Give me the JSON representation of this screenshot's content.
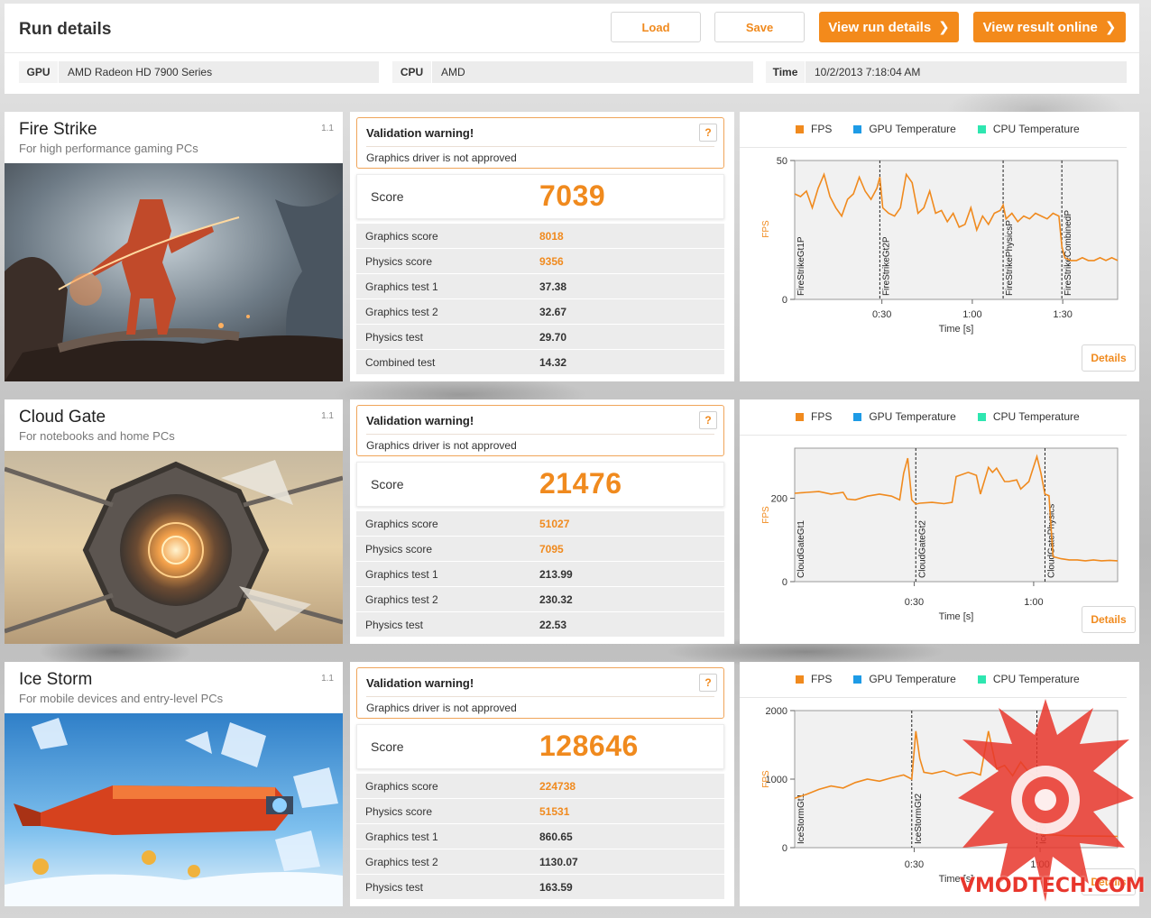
{
  "header": {
    "title": "Run details",
    "load_label": "Load",
    "save_label": "Save",
    "view_run_label": "View run details",
    "view_online_label": "View result online",
    "gpu_key": "GPU",
    "gpu_value": "AMD Radeon HD 7900 Series",
    "cpu_key": "CPU",
    "cpu_value": "AMD",
    "time_key": "Time",
    "time_value": "10/2/2013 7:18:04 AM"
  },
  "common": {
    "warning_title": "Validation warning!",
    "warning_text": "Graphics driver is not approved",
    "help_label": "?",
    "score_label": "Score",
    "details_label": "Details",
    "legend": [
      {
        "label": "FPS",
        "color": "#f08a1e"
      },
      {
        "label": "GPU Temperature",
        "color": "#1e9be6"
      },
      {
        "label": "CPU Temperature",
        "color": "#2ee6b0"
      }
    ],
    "ylabel": "FPS",
    "xlabel": "Time [s]"
  },
  "benchmarks": [
    {
      "name": "Fire Strike",
      "subtitle": "For high performance gaming PCs",
      "version": "1.1",
      "score": "7039",
      "rows": [
        {
          "label": "Graphics score",
          "value": "8018",
          "accent": true
        },
        {
          "label": "Physics score",
          "value": "9356",
          "accent": true
        },
        {
          "label": "Graphics test 1",
          "value": "37.38",
          "accent": false
        },
        {
          "label": "Graphics test 2",
          "value": "32.67",
          "accent": false
        },
        {
          "label": "Physics test",
          "value": "29.70",
          "accent": false
        },
        {
          "label": "Combined test",
          "value": "14.32",
          "accent": false
        }
      ]
    },
    {
      "name": "Cloud Gate",
      "subtitle": "For notebooks and home PCs",
      "version": "1.1",
      "score": "21476",
      "rows": [
        {
          "label": "Graphics score",
          "value": "51027",
          "accent": true
        },
        {
          "label": "Physics score",
          "value": "7095",
          "accent": true
        },
        {
          "label": "Graphics test 1",
          "value": "213.99",
          "accent": false
        },
        {
          "label": "Graphics test 2",
          "value": "230.32",
          "accent": false
        },
        {
          "label": "Physics test",
          "value": "22.53",
          "accent": false
        }
      ]
    },
    {
      "name": "Ice Storm",
      "subtitle": "For mobile devices and entry-level PCs",
      "version": "1.1",
      "score": "128646",
      "rows": [
        {
          "label": "Graphics score",
          "value": "224738",
          "accent": true
        },
        {
          "label": "Physics score",
          "value": "51531",
          "accent": true
        },
        {
          "label": "Graphics test 1",
          "value": "860.65",
          "accent": false
        },
        {
          "label": "Graphics test 2",
          "value": "1130.07",
          "accent": false
        },
        {
          "label": "Physics test",
          "value": "163.59",
          "accent": false
        }
      ]
    }
  ],
  "chart_data": [
    {
      "type": "line",
      "title": "",
      "xlabel": "Time [s]",
      "ylabel": "FPS",
      "xlim": [
        0,
        110
      ],
      "ylim": [
        0,
        50
      ],
      "yticks": [
        "50",
        "0"
      ],
      "xticks": [
        "0:30",
        "1:00",
        "1:30"
      ],
      "markers": [
        {
          "label": "FireStrikeGt1P",
          "t": 0
        },
        {
          "label": "FireStrikeGt2P",
          "t": 29
        },
        {
          "label": "FireStrikePhysicsP",
          "t": 71
        },
        {
          "label": "FireStrikeCombinedP",
          "t": 91
        }
      ],
      "series": [
        {
          "name": "FPS",
          "x": [
            0,
            2,
            4,
            6,
            8,
            10,
            12,
            14,
            16,
            18,
            20,
            22,
            24,
            26,
            28,
            29,
            30,
            32,
            34,
            36,
            38,
            40,
            42,
            44,
            46,
            48,
            50,
            52,
            54,
            56,
            58,
            60,
            62,
            64,
            66,
            68,
            70,
            71,
            72,
            74,
            76,
            78,
            80,
            82,
            84,
            86,
            88,
            90,
            91,
            92,
            94,
            96,
            98,
            100,
            102,
            104,
            106,
            108,
            110
          ],
          "y": [
            38,
            37,
            39,
            33,
            40,
            45,
            37,
            33,
            30,
            36,
            38,
            44,
            39,
            36,
            40,
            44,
            33,
            31,
            30,
            33,
            45,
            42,
            31,
            33,
            39,
            31,
            32,
            28,
            31,
            26,
            27,
            33,
            25,
            30,
            27,
            31,
            32,
            34,
            29,
            31,
            28,
            30,
            29,
            31,
            30,
            29,
            31,
            30,
            19,
            15,
            14,
            14,
            15,
            14,
            14,
            15,
            14,
            15,
            14
          ]
        }
      ]
    },
    {
      "type": "line",
      "title": "",
      "xlabel": "Time [s]",
      "ylabel": "FPS",
      "xlim": [
        0,
        80
      ],
      "ylim": [
        0,
        320
      ],
      "yticks": [
        "200",
        "0"
      ],
      "xticks": [
        "0:30",
        "1:00"
      ],
      "markers": [
        {
          "label": "CloudGateGt1",
          "t": 0
        },
        {
          "label": "CloudGateGt2",
          "t": 30
        },
        {
          "label": "CloudGatePhysics",
          "t": 62
        }
      ],
      "series": [
        {
          "name": "FPS",
          "x": [
            0,
            3,
            6,
            9,
            12,
            13,
            15,
            18,
            21,
            24,
            26,
            27,
            28,
            29,
            30,
            31,
            34,
            37,
            39,
            40,
            43,
            45,
            46,
            48,
            49,
            50,
            52,
            53,
            55,
            56,
            58,
            60,
            61,
            62,
            63,
            64,
            66,
            68,
            70,
            72,
            74,
            76,
            78,
            80
          ],
          "y": [
            212,
            214,
            216,
            210,
            214,
            198,
            196,
            205,
            210,
            205,
            196,
            260,
            296,
            196,
            186,
            188,
            190,
            187,
            190,
            252,
            262,
            255,
            210,
            274,
            262,
            272,
            240,
            240,
            244,
            222,
            240,
            300,
            260,
            210,
            206,
            60,
            55,
            52,
            52,
            50,
            52,
            50,
            51,
            50
          ]
        }
      ]
    },
    {
      "type": "line",
      "title": "",
      "xlabel": "Time [s]",
      "ylabel": "FPS",
      "xlim": [
        0,
        80
      ],
      "ylim": [
        0,
        2000
      ],
      "yticks": [
        "2000",
        "1000",
        "0"
      ],
      "xticks": [
        "0:30",
        "1:00"
      ],
      "markers": [
        {
          "label": "IceStormGt1",
          "t": 0
        },
        {
          "label": "IceStormGt2",
          "t": 29
        },
        {
          "label": "IceStormPhysics",
          "t": 60
        }
      ],
      "series": [
        {
          "name": "FPS",
          "x": [
            0,
            3,
            6,
            9,
            12,
            15,
            18,
            21,
            24,
            27,
            29,
            30,
            31,
            32,
            34,
            37,
            40,
            42,
            44,
            46,
            48,
            50,
            52,
            54,
            56,
            58,
            60,
            61,
            62,
            64,
            67,
            70,
            73,
            76,
            80
          ],
          "y": [
            720,
            780,
            850,
            900,
            870,
            950,
            1000,
            970,
            1020,
            1060,
            1000,
            1700,
            1300,
            1100,
            1080,
            1120,
            1050,
            1080,
            1100,
            1060,
            1700,
            1150,
            1200,
            1050,
            1250,
            1100,
            1020,
            200,
            190,
            185,
            175,
            170,
            170,
            168,
            165
          ]
        }
      ]
    }
  ],
  "watermark": "VMODTECH.COM"
}
